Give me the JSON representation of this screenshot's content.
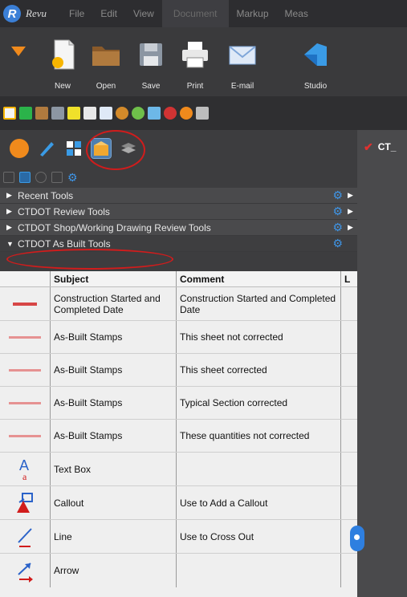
{
  "app": {
    "brand": "Revu"
  },
  "menu": [
    "File",
    "Edit",
    "View",
    "Document",
    "Markup",
    "Meas"
  ],
  "ribbon": {
    "buttons": [
      "New",
      "Open",
      "Save",
      "Print",
      "E-mail",
      "Studio"
    ]
  },
  "document_tab": {
    "label": "CT_"
  },
  "tool_groups": [
    {
      "label": "Recent Tools",
      "expanded": false
    },
    {
      "label": "CTDOT Review Tools",
      "expanded": false
    },
    {
      "label": "CTDOT Shop/Working Drawing Review Tools",
      "expanded": false
    },
    {
      "label": "CTDOT As Built Tools",
      "expanded": true
    }
  ],
  "table": {
    "headers": [
      "Subject",
      "Comment",
      "L"
    ],
    "rows": [
      {
        "subject": "Construction Started and Completed Date",
        "comment": "Construction Started and Completed Date",
        "icon": "date-stamp-icon"
      },
      {
        "subject": "As-Built Stamps",
        "comment": "This sheet not corrected",
        "icon": "stamp-icon"
      },
      {
        "subject": "As-Built Stamps",
        "comment": "This sheet corrected",
        "icon": "stamp-icon"
      },
      {
        "subject": "As-Built Stamps",
        "comment": "Typical Section corrected",
        "icon": "stamp-icon"
      },
      {
        "subject": "As-Built Stamps",
        "comment": "These quantities not corrected",
        "icon": "stamp-icon"
      },
      {
        "subject": "Text Box",
        "comment": "",
        "icon": "text-box-icon"
      },
      {
        "subject": "Callout",
        "comment": "Use to Add a Callout",
        "icon": "callout-icon"
      },
      {
        "subject": "Line",
        "comment": "Use to Cross Out",
        "icon": "line-icon"
      },
      {
        "subject": "Arrow",
        "comment": "",
        "icon": "arrow-icon"
      }
    ]
  },
  "colors": {
    "accent": "#3f95e6",
    "highlight_ring": "#d11c1c",
    "orange": "#f08a1c"
  }
}
